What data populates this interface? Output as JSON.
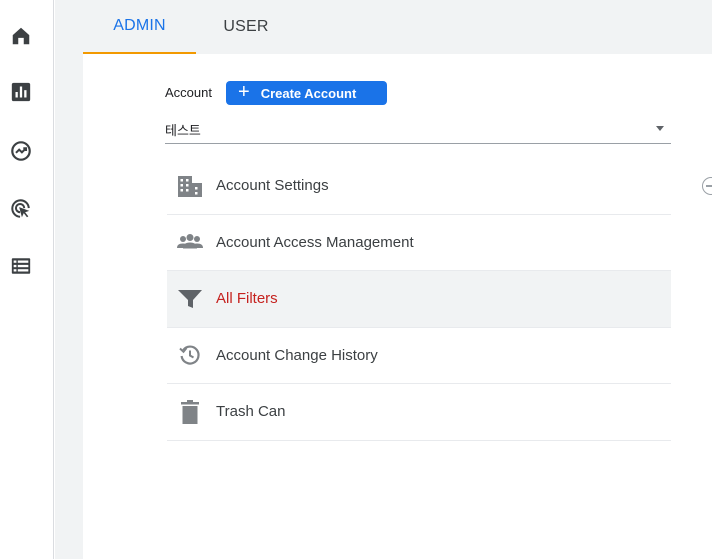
{
  "colors": {
    "accent": "#1a73e8",
    "tab_underline": "#f29900",
    "active_text": "#c5221f",
    "icon": "#5f6368"
  },
  "rail": {
    "items": [
      {
        "icon": "home-icon"
      },
      {
        "icon": "reports-icon"
      },
      {
        "icon": "explore-icon"
      },
      {
        "icon": "advertising-icon"
      },
      {
        "icon": "list-icon"
      }
    ]
  },
  "tabs": [
    {
      "label": "ADMIN",
      "selected": true
    },
    {
      "label": "USER",
      "selected": false
    }
  ],
  "account": {
    "label": "Account",
    "create_button": "Create Account",
    "selected_value": "테스트"
  },
  "menu": [
    {
      "label": "Account Settings",
      "icon": "building-icon",
      "active": false
    },
    {
      "label": "Account Access Management",
      "icon": "people-icon",
      "active": false
    },
    {
      "label": "All Filters",
      "icon": "filter-icon",
      "active": true
    },
    {
      "label": "Account Change History",
      "icon": "history-icon",
      "active": false
    },
    {
      "label": "Trash Can",
      "icon": "trash-icon",
      "active": false
    }
  ]
}
